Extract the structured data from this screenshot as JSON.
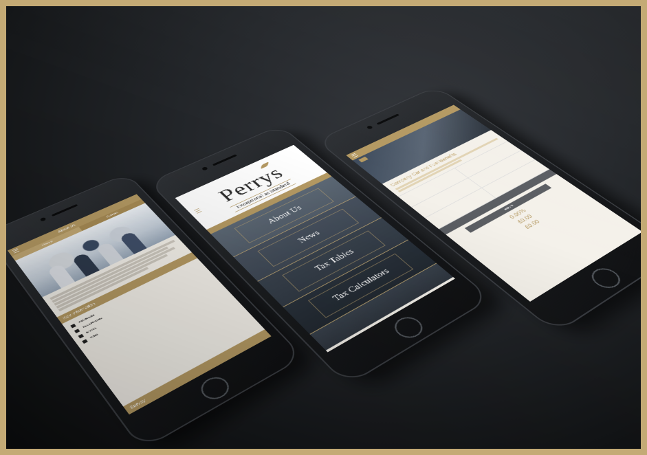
{
  "left_phone": {
    "topbar_title": "About Us",
    "tabs": [
      "Profile",
      "Contact"
    ],
    "contact": {
      "section_label": "Key Information",
      "address_label": "ADDRESS",
      "telephone_label": "TELEPHONE",
      "email_label": "EMAIL",
      "web_label": "WEB"
    },
    "footer_label": "Survey"
  },
  "middle_phone": {
    "brand": "Perrys",
    "tagline": "Exceptional as Standard",
    "menu": [
      "About Us",
      "News",
      "Tax Tables",
      "Tax Calculators"
    ]
  },
  "right_phone": {
    "calculator_title": "Company Car and Fuel Benefits",
    "results_label": "Results",
    "results": [
      {
        "value": "0.00%"
      },
      {
        "value": "£0.00"
      },
      {
        "value": "£0.00"
      }
    ]
  },
  "colors": {
    "gold": "#b59a63",
    "dark_background": "#1b1d20",
    "frame": "#c4aa75"
  }
}
